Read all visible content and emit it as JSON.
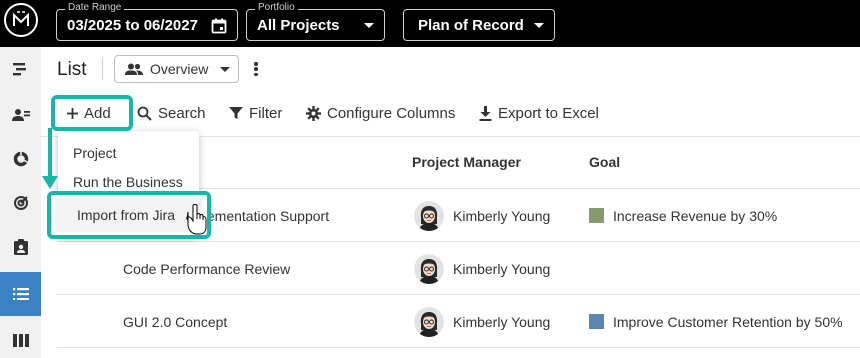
{
  "topbar": {
    "logo": "mosaic-logo",
    "date_range": {
      "legend": "Date Range",
      "value": "03/2025 to 06/2027",
      "icon": "calendar-icon"
    },
    "portfolio": {
      "legend": "Portfolio",
      "value": "All Projects"
    },
    "plan": {
      "value": "Plan of Record"
    }
  },
  "sidebar": {
    "items": [
      {
        "icon": "roadmap-icon"
      },
      {
        "icon": "people-icon"
      },
      {
        "icon": "donut-chart-icon"
      },
      {
        "icon": "target-icon"
      },
      {
        "icon": "assignment-icon"
      },
      {
        "icon": "list-icon",
        "active": true
      },
      {
        "icon": "columns-icon"
      }
    ],
    "active_color": "#3b82c4"
  },
  "header": {
    "title": "List",
    "view_select": {
      "value": "Overview",
      "icon": "people-icon"
    }
  },
  "toolbar": {
    "add": "Add",
    "search": "Search",
    "filter": "Filter",
    "configure": "Configure Columns",
    "export": "Export to Excel"
  },
  "add_menu": {
    "items": [
      "Project",
      "Run the Business",
      "Import from Jira"
    ],
    "highlighted": "Import from Jira"
  },
  "table": {
    "columns": [
      "Project Manager",
      "Goal"
    ],
    "rows": [
      {
        "project": "Implementation Support",
        "visible_project": "plementation Support",
        "manager": "Kimberly Young",
        "goal": "Increase Revenue by 30%",
        "goal_color": "#869a6d"
      },
      {
        "project": "Code Performance Review",
        "manager": "Kimberly Young",
        "goal": "",
        "goal_color": ""
      },
      {
        "project": "GUI 2.0 Concept",
        "manager": "Kimberly Young",
        "goal": "Improve Customer Retention by 50%",
        "goal_color": "#5a86b0"
      }
    ]
  },
  "colors": {
    "highlight": "#17b6a6",
    "topbar": "#000000"
  }
}
